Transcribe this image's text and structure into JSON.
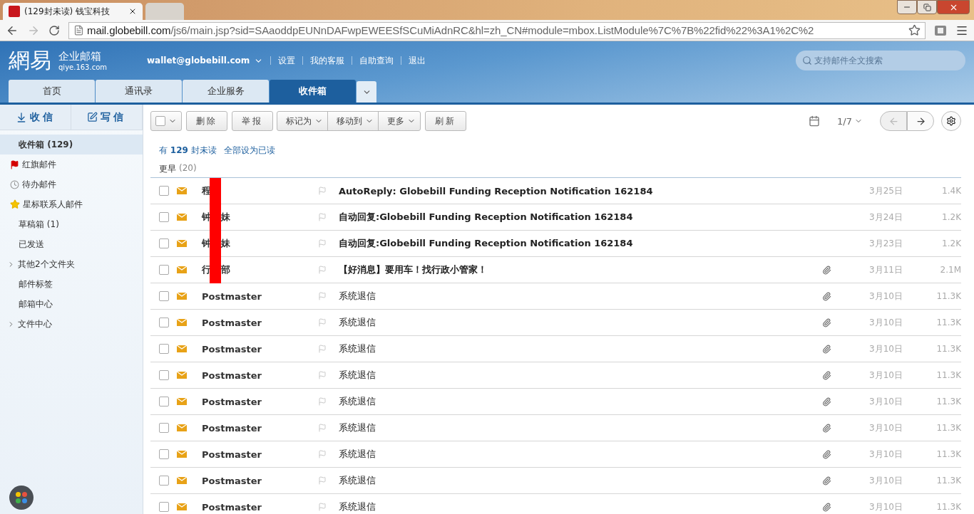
{
  "browser": {
    "tabs": [
      {
        "title": "(129封未读) 钱宝科技",
        "selected": true
      },
      {
        "selected": false
      }
    ],
    "url_host": "mail.globebill.com",
    "url_path": "/js6/main.jsp?sid=SAaoddpEUNnDAFwpEWEESfSCuMiAdnRC&hl=zh_CN#module=mbox.ListModule%7C%7B%22fid%22%3A1%2C%2"
  },
  "header": {
    "logo": "網易",
    "product": "企业邮箱",
    "domain": "qiye.163.com",
    "account": "wallet@globebill.com",
    "links": [
      "设置",
      "我的客服",
      "自助查询",
      "退出"
    ],
    "search": {
      "placeholder": "支持邮件全文搜索"
    }
  },
  "nav_tabs": [
    {
      "label": "首页",
      "selected": false
    },
    {
      "label": "通讯录",
      "selected": false
    },
    {
      "label": "企业服务",
      "selected": false
    },
    {
      "label": "收件箱",
      "selected": true
    }
  ],
  "sidebar": {
    "actions": [
      {
        "kind": "receive",
        "label": "收信"
      },
      {
        "kind": "compose",
        "label": "写信"
      }
    ],
    "items": [
      {
        "label": "收件箱",
        "count": "(129)",
        "kind": "plain",
        "selected": true
      },
      {
        "label": "红旗邮件",
        "kind": "flag",
        "selected": false
      },
      {
        "label": "待办邮件",
        "kind": "clock",
        "selected": false
      },
      {
        "label": "星标联系人邮件",
        "kind": "star",
        "selected": false
      },
      {
        "label": "草稿箱",
        "count": "(1)",
        "kind": "plain",
        "selected": false
      },
      {
        "label": "已发送",
        "kind": "plain",
        "selected": false
      },
      {
        "label": "其他2个文件夹",
        "kind": "folder",
        "selected": false
      },
      {
        "label": "邮件标签",
        "kind": "plain",
        "selected": false
      },
      {
        "label": "邮箱中心",
        "kind": "plain",
        "selected": false
      },
      {
        "label": "文件中心",
        "kind": "folder",
        "selected": false
      }
    ]
  },
  "toolbar": {
    "buttons": [
      "删除",
      "举报"
    ],
    "menus": [
      "标记为",
      "移动到",
      "更多"
    ],
    "refresh": "刷新",
    "page": "1/7",
    "prev_disabled": true
  },
  "unread_notice": {
    "prefix": "有",
    "count": "129",
    "suffix": "封未读",
    "mark_all": "全部设为已读"
  },
  "group": {
    "label": "更早",
    "count": "(20)"
  },
  "messages": [
    {
      "sender": "程",
      "redacted": true,
      "subject": "AutoReply: Globebill Funding Reception Notification 162184",
      "unread": true,
      "attachment": false,
      "date": "3月25日",
      "size": "1.4K",
      "checked": false
    },
    {
      "sender": "钟",
      "sender_tail": "妹",
      "redacted": true,
      "subject": "自动回复:Globebill Funding Reception Notification 162184",
      "unread": true,
      "attachment": false,
      "date": "3月24日",
      "size": "1.2K",
      "checked": false
    },
    {
      "sender": "钟",
      "sender_tail": "妹",
      "redacted": true,
      "subject": "自动回复:Globebill Funding Reception Notification 162184",
      "unread": true,
      "attachment": false,
      "date": "3月23日",
      "size": "1.2K",
      "checked": false
    },
    {
      "sender": "行",
      "sender_tail": "部",
      "redacted": true,
      "subject": "【好消息】要用车！找行政小管家！",
      "unread": true,
      "attachment": true,
      "date": "3月11日",
      "size": "2.1M",
      "checked": false
    },
    {
      "sender": "Postmaster",
      "redacted": false,
      "subject": "系统退信",
      "unread": false,
      "attachment": true,
      "date": "3月10日",
      "size": "11.3K",
      "checked": false
    },
    {
      "sender": "Postmaster",
      "redacted": false,
      "subject": "系统退信",
      "unread": false,
      "attachment": true,
      "date": "3月10日",
      "size": "11.3K",
      "checked": false
    },
    {
      "sender": "Postmaster",
      "redacted": false,
      "subject": "系统退信",
      "unread": false,
      "attachment": true,
      "date": "3月10日",
      "size": "11.3K",
      "checked": false
    },
    {
      "sender": "Postmaster",
      "redacted": false,
      "subject": "系统退信",
      "unread": false,
      "attachment": true,
      "date": "3月10日",
      "size": "11.3K",
      "checked": false
    },
    {
      "sender": "Postmaster",
      "redacted": false,
      "subject": "系统退信",
      "unread": false,
      "attachment": true,
      "date": "3月10日",
      "size": "11.3K",
      "checked": false
    },
    {
      "sender": "Postmaster",
      "redacted": false,
      "subject": "系统退信",
      "unread": false,
      "attachment": true,
      "date": "3月10日",
      "size": "11.3K",
      "checked": false
    },
    {
      "sender": "Postmaster",
      "redacted": false,
      "subject": "系统退信",
      "unread": false,
      "attachment": true,
      "date": "3月10日",
      "size": "11.3K",
      "checked": false
    },
    {
      "sender": "Postmaster",
      "redacted": false,
      "subject": "系统退信",
      "unread": false,
      "attachment": true,
      "date": "3月10日",
      "size": "11.3K",
      "checked": false
    },
    {
      "sender": "Postmaster",
      "redacted": false,
      "subject": "系统退信",
      "unread": false,
      "attachment": true,
      "date": "3月10日",
      "size": "11.3K",
      "checked": false
    }
  ]
}
